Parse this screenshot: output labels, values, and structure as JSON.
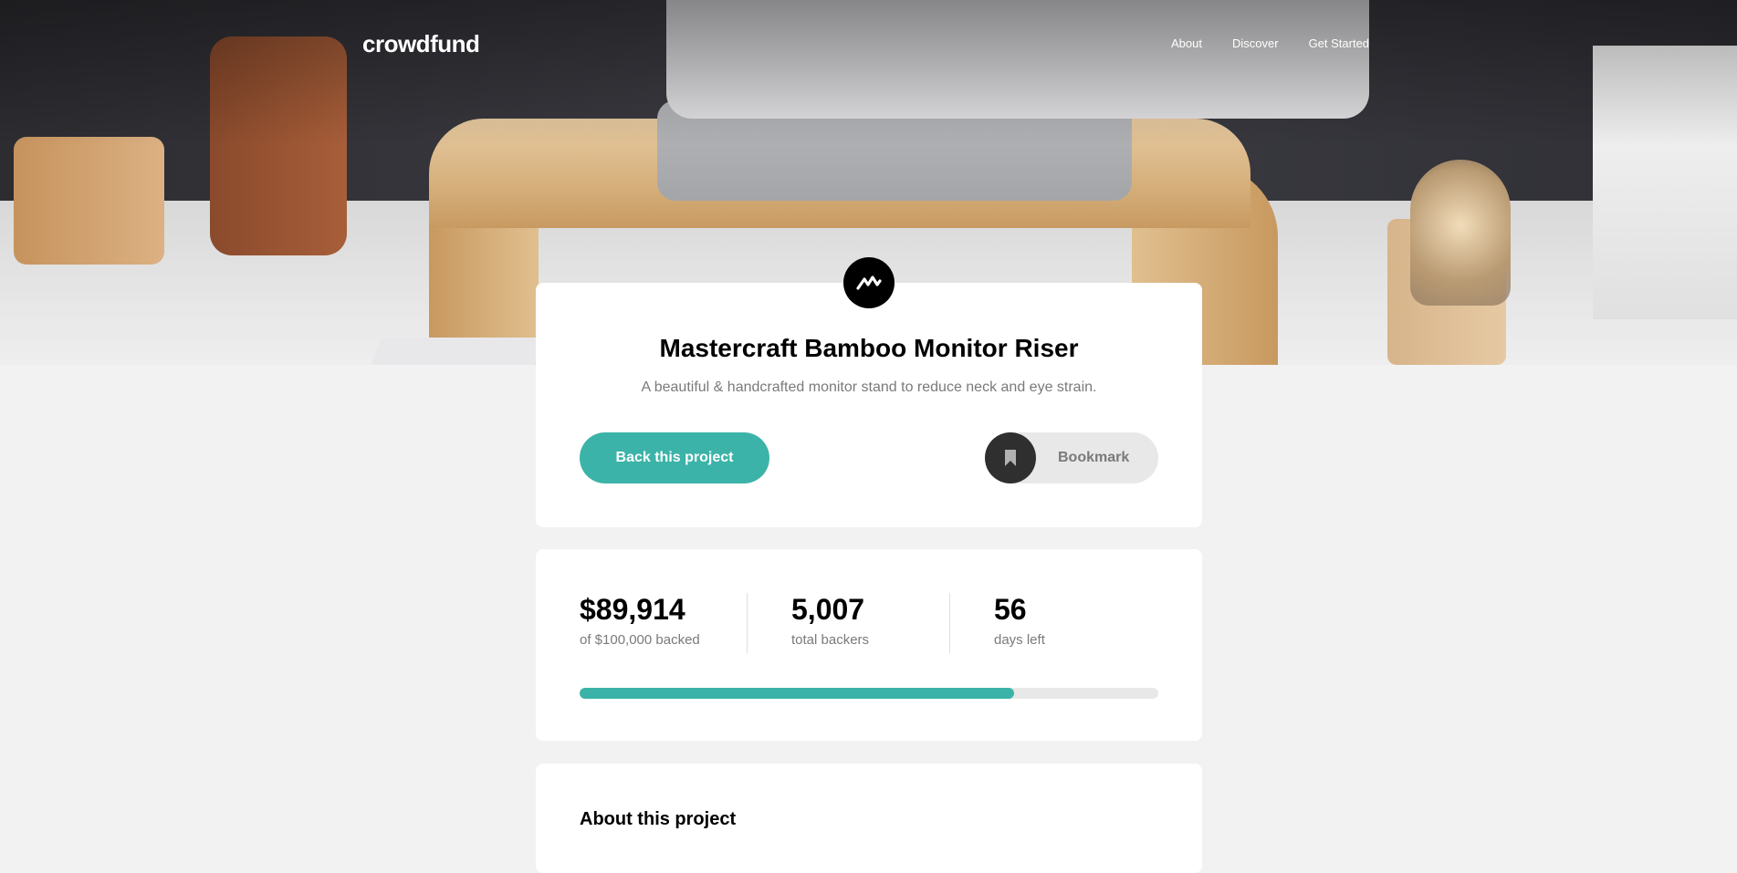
{
  "nav": {
    "logo": "crowdfund",
    "links": [
      "About",
      "Discover",
      "Get Started"
    ]
  },
  "project": {
    "title": "Mastercraft Bamboo Monitor Riser",
    "subtitle": "A beautiful & handcrafted monitor stand to reduce neck and eye strain.",
    "back_label": "Back this project",
    "bookmark_label": "Bookmark"
  },
  "stats": {
    "backed_amount": "$89,914",
    "backed_label": "of $100,000 backed",
    "backers": "5,007",
    "backers_label": "total backers",
    "days": "56",
    "days_label": "days left",
    "progress_fraction": 0.75
  },
  "about": {
    "title": "About this project"
  },
  "colors": {
    "accent": "#3cb3a8",
    "dark": "#2f2f2f",
    "background": "#f2f2f2"
  },
  "icons": {
    "brand": "mastercraft-logo-icon",
    "bookmark": "bookmark-icon"
  }
}
